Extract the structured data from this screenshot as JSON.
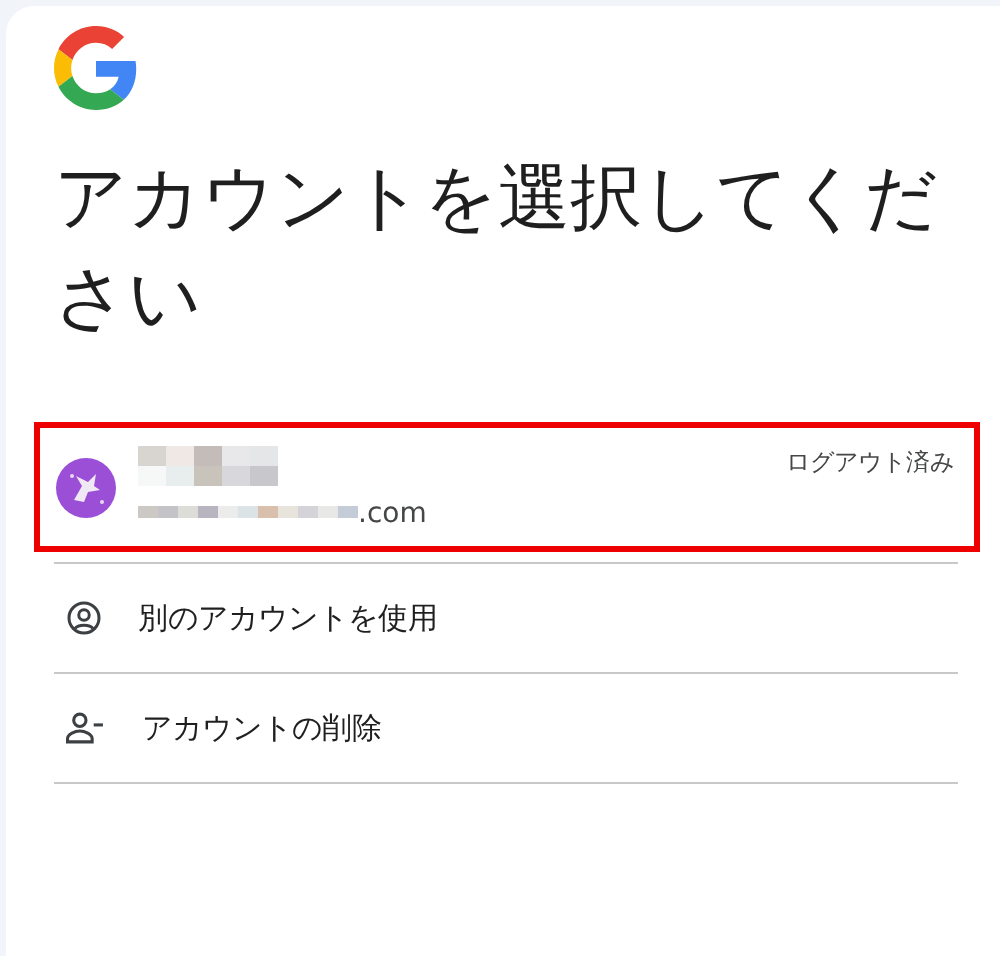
{
  "title": "アカウントを選択してください",
  "accounts": [
    {
      "email_suffix": ".com",
      "status": "ログアウト済み",
      "highlighted": true
    }
  ],
  "actions": [
    {
      "kind": "use-other",
      "label": "別のアカウントを使用"
    },
    {
      "kind": "remove",
      "label": "アカウントの削除"
    }
  ]
}
